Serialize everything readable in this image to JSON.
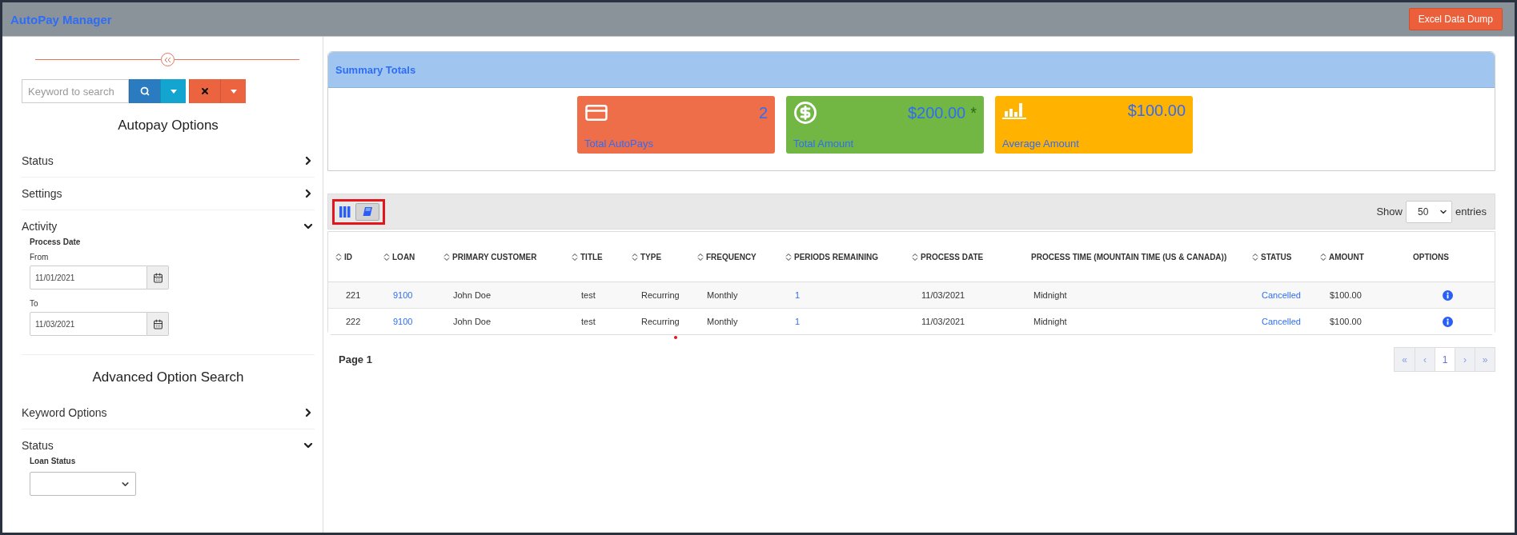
{
  "header": {
    "title": "AutoPay Manager",
    "export_button": "Excel Data Dump"
  },
  "sidebar": {
    "search": {
      "placeholder": "Keyword to search"
    },
    "sections": [
      {
        "heading": "Autopay Options",
        "groups": [
          {
            "label": "Status",
            "expanded": false
          },
          {
            "label": "Settings",
            "expanded": false
          },
          {
            "label": "Activity",
            "expanded": true,
            "subheading": "Process Date",
            "fields": [
              {
                "kind": "date",
                "label": "From",
                "value": "11/01/2021"
              },
              {
                "kind": "date",
                "label": "To",
                "value": "11/03/2021"
              }
            ]
          }
        ]
      },
      {
        "heading": "Advanced Option Search",
        "groups": [
          {
            "label": "Keyword Options",
            "expanded": false
          },
          {
            "label": "Status",
            "expanded": true,
            "subheading": "Loan Status",
            "fields": [
              {
                "kind": "select"
              }
            ]
          }
        ]
      }
    ]
  },
  "summary": {
    "title": "Summary Totals",
    "cards": [
      {
        "label": "Total AutoPays",
        "value": "2",
        "color": "#ef6e4a"
      },
      {
        "label": "Total Amount",
        "value": "$200.00",
        "note": "*",
        "color": "#72b743"
      },
      {
        "label": "Average Amount",
        "value": "$100.00",
        "color": "#ffb300"
      }
    ]
  },
  "table": {
    "view_buttons": [
      {
        "selected": false
      },
      {
        "selected": true
      }
    ],
    "page_size": {
      "label_before": "Show",
      "value": "50",
      "label_after": "entries"
    },
    "columns": [
      {
        "label": "ID",
        "sortable": true,
        "kind": "number"
      },
      {
        "label": "LOAN",
        "sortable": true,
        "kind": "link"
      },
      {
        "label": "PRIMARY CUSTOMER",
        "sortable": true,
        "kind": "text"
      },
      {
        "label": "TITLE",
        "sortable": true,
        "kind": "text"
      },
      {
        "label": "TYPE",
        "sortable": true,
        "kind": "text"
      },
      {
        "label": "FREQUENCY",
        "sortable": true,
        "kind": "text"
      },
      {
        "label": "PERIODS REMAINING",
        "sortable": true,
        "kind": "link"
      },
      {
        "label": "PROCESS DATE",
        "sortable": true,
        "kind": "text"
      },
      {
        "label": "PROCESS TIME (MOUNTAIN TIME (US & CANADA))",
        "sortable": false,
        "kind": "text"
      },
      {
        "label": "STATUS",
        "sortable": true,
        "kind": "link"
      },
      {
        "label": "AMOUNT",
        "sortable": true,
        "kind": "text"
      },
      {
        "label": "OPTIONS",
        "sortable": false,
        "kind": "action"
      }
    ],
    "rows": [
      [
        "221",
        "9100",
        "John Doe",
        "test",
        "Recurring",
        "Monthly",
        "1",
        "11/03/2021",
        "Midnight",
        "Cancelled",
        "$100.00",
        null
      ],
      [
        "222",
        "9100",
        "John Doe",
        "test",
        "Recurring",
        "Monthly",
        "1",
        "11/03/2021",
        "Midnight",
        "Cancelled",
        "$100.00",
        null
      ]
    ],
    "page_label": "Page 1",
    "pagination": [
      {
        "label": "«",
        "selected": false
      },
      {
        "label": "‹",
        "selected": false
      },
      {
        "label": "1",
        "selected": true
      },
      {
        "label": "›",
        "selected": false
      },
      {
        "label": "»",
        "selected": false
      }
    ]
  }
}
